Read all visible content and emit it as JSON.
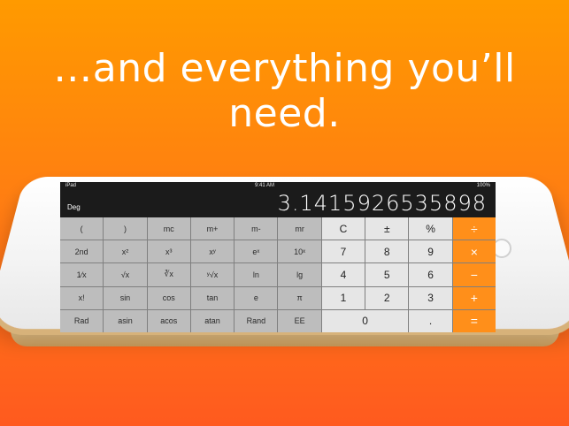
{
  "headline": "…and everything you’ll need.",
  "status": {
    "carrier": "iPad",
    "time": "9:41 AM",
    "battery": "100%"
  },
  "calculator": {
    "mode": "Deg",
    "display": "3.14159265358 98",
    "display_exact": "3.1415926535898",
    "keys_row1": [
      "(",
      ")",
      "mc",
      "m+",
      "m-",
      "mr",
      "C",
      "±",
      "%",
      "÷"
    ],
    "keys_row2": [
      "2nd",
      "x²",
      "x³",
      "xʸ",
      "eˣ",
      "10ˣ",
      "7",
      "8",
      "9",
      "×"
    ],
    "keys_row3": [
      "1⁄x",
      "√x",
      "∛x",
      "ʸ√x",
      "ln",
      "lg",
      "4",
      "5",
      "6",
      "−"
    ],
    "keys_row4": [
      "x!",
      "sin",
      "cos",
      "tan",
      "e",
      "π",
      "1",
      "2",
      "3",
      "+"
    ],
    "keys_row5": [
      "Rad",
      "asin",
      "acos",
      "atan",
      "Rand",
      "EE",
      "0",
      ".",
      "="
    ]
  },
  "colors": {
    "orange": "#ff8f1a",
    "bgTop": "#ff9a00",
    "bgBottom": "#ff5a1f"
  }
}
